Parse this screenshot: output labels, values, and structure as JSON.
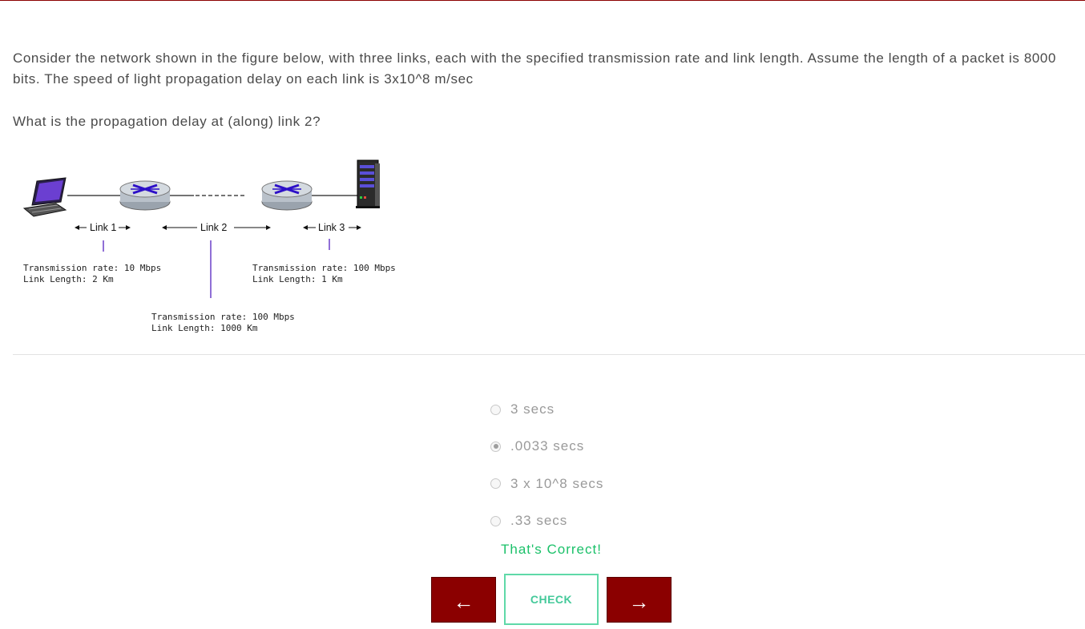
{
  "question": {
    "paragraph1": "Consider the network shown in the figure below, with three links, each with the specified transmission rate and link length. Assume the length of a packet is 8000 bits. The speed of light propagation delay on each link is 3x10^8 m/sec",
    "paragraph2": "What is the propagation delay at (along) link 2?"
  },
  "figure": {
    "link1_label": "Link 1",
    "link2_label": "Link 2",
    "link3_label": "Link 3",
    "link1_rate": "Transmission rate: 10 Mbps",
    "link1_length": "Link Length: 2 Km",
    "link2_rate": "Transmission rate: 100 Mbps",
    "link2_length": "Link Length: 1000 Km",
    "link3_rate": "Transmission rate: 100 Mbps",
    "link3_length": "Link Length: 1 Km"
  },
  "options": [
    {
      "label": "3 secs",
      "selected": false
    },
    {
      "label": ".0033 secs",
      "selected": true
    },
    {
      "label": "3 x 10^8 secs",
      "selected": false
    },
    {
      "label": ".33 secs",
      "selected": false
    }
  ],
  "feedback": "That's Correct!",
  "buttons": {
    "prev_label": "←",
    "check_label": "CHECK",
    "next_label": "→"
  },
  "colors": {
    "accent": "#8b0000",
    "success": "#1cc16a",
    "check_border": "#5fd9a8"
  }
}
